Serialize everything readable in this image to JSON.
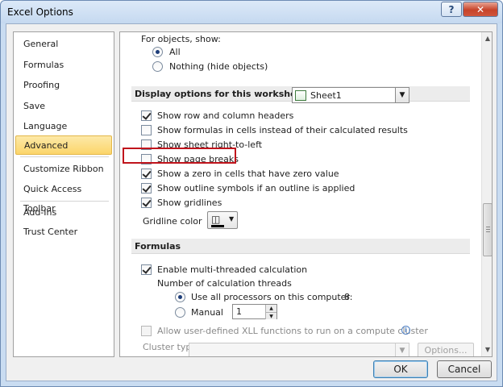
{
  "window": {
    "title": "Excel Options",
    "help_glyph": "?",
    "close_glyph": "✕"
  },
  "sidebar": {
    "items": [
      {
        "label": "General"
      },
      {
        "label": "Formulas"
      },
      {
        "label": "Proofing"
      },
      {
        "label": "Save"
      },
      {
        "label": "Language"
      },
      {
        "label": "Advanced",
        "active": true
      },
      {
        "label": "Customize Ribbon"
      },
      {
        "label": "Quick Access Toolbar"
      },
      {
        "label": "Add-Ins"
      },
      {
        "label": "Trust Center"
      }
    ]
  },
  "objects": {
    "heading": "For objects, show:",
    "all": "All",
    "nothing": "Nothing (hide objects)"
  },
  "worksheet": {
    "section_label": "Display options for this worksheet:",
    "selected_sheet": "Sheet1",
    "options": [
      {
        "label": "Show row and column headers",
        "checked": true
      },
      {
        "label": "Show formulas in cells instead of their calculated results",
        "checked": false
      },
      {
        "label": "Show sheet right-to-left",
        "checked": false
      },
      {
        "label": "Show page breaks",
        "checked": false
      },
      {
        "label": "Show a zero in cells that have zero value",
        "checked": true
      },
      {
        "label": "Show outline symbols if an outline is applied",
        "checked": true
      },
      {
        "label": "Show gridlines",
        "checked": true
      }
    ],
    "gridline_color_label": "Gridline color"
  },
  "formulas": {
    "section_label": "Formulas",
    "multithread_label": "Enable multi-threaded calculation",
    "threads_heading": "Number of calculation threads",
    "all_processors_label": "Use all processors on this computer:",
    "processor_count": "8",
    "manual_label": "Manual",
    "manual_value": "1",
    "xll_label": "Allow user-defined XLL functions to run on a compute cluster",
    "cluster_type_label": "Cluster type:",
    "options_button": "Options..."
  },
  "footer": {
    "ok": "OK",
    "cancel": "Cancel"
  },
  "colors": {
    "active_item": "#fbd56a",
    "highlight_box": "#c0141c",
    "close_button": "#c7432a"
  }
}
